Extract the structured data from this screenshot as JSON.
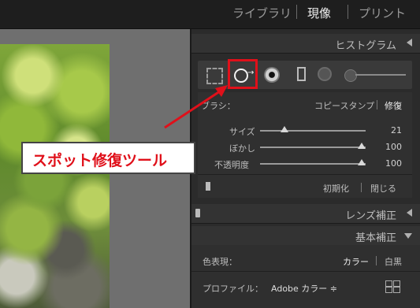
{
  "topbar": {
    "modules": [
      "ライブラリ",
      "現像",
      "プリント"
    ],
    "active": "現像"
  },
  "panel": {
    "histogram_title": "ヒストグラム",
    "tools": {
      "crop": "crop-overlay-icon",
      "spot": "spot-removal-icon",
      "redeye": "red-eye-icon",
      "graduated": "graduated-filter-icon",
      "radial": "radial-filter-icon",
      "brush": "adjustment-brush-icon"
    },
    "spot": {
      "brush_label": "ブラシ：",
      "mode_clone": "コピースタンプ",
      "mode_heal": "修復",
      "sliders": [
        {
          "label": "サイズ",
          "value": "21",
          "fill": 0.23
        },
        {
          "label": "ぼかし",
          "value": "100",
          "fill": 1.0
        },
        {
          "label": "不透明度",
          "value": "100",
          "fill": 1.0
        }
      ],
      "reset": "初期化",
      "close": "閉じる"
    },
    "lens_title": "レンズ補正",
    "basic_title": "基本補正",
    "basic": {
      "treatment_label": "色表現：",
      "color": "カラー",
      "bw": "白黒",
      "profile_label": "プロファイル：",
      "profile_value": "Adobe カラー ≑"
    }
  },
  "callout": {
    "text": "スポット修復ツール",
    "color": "#e0101a"
  }
}
